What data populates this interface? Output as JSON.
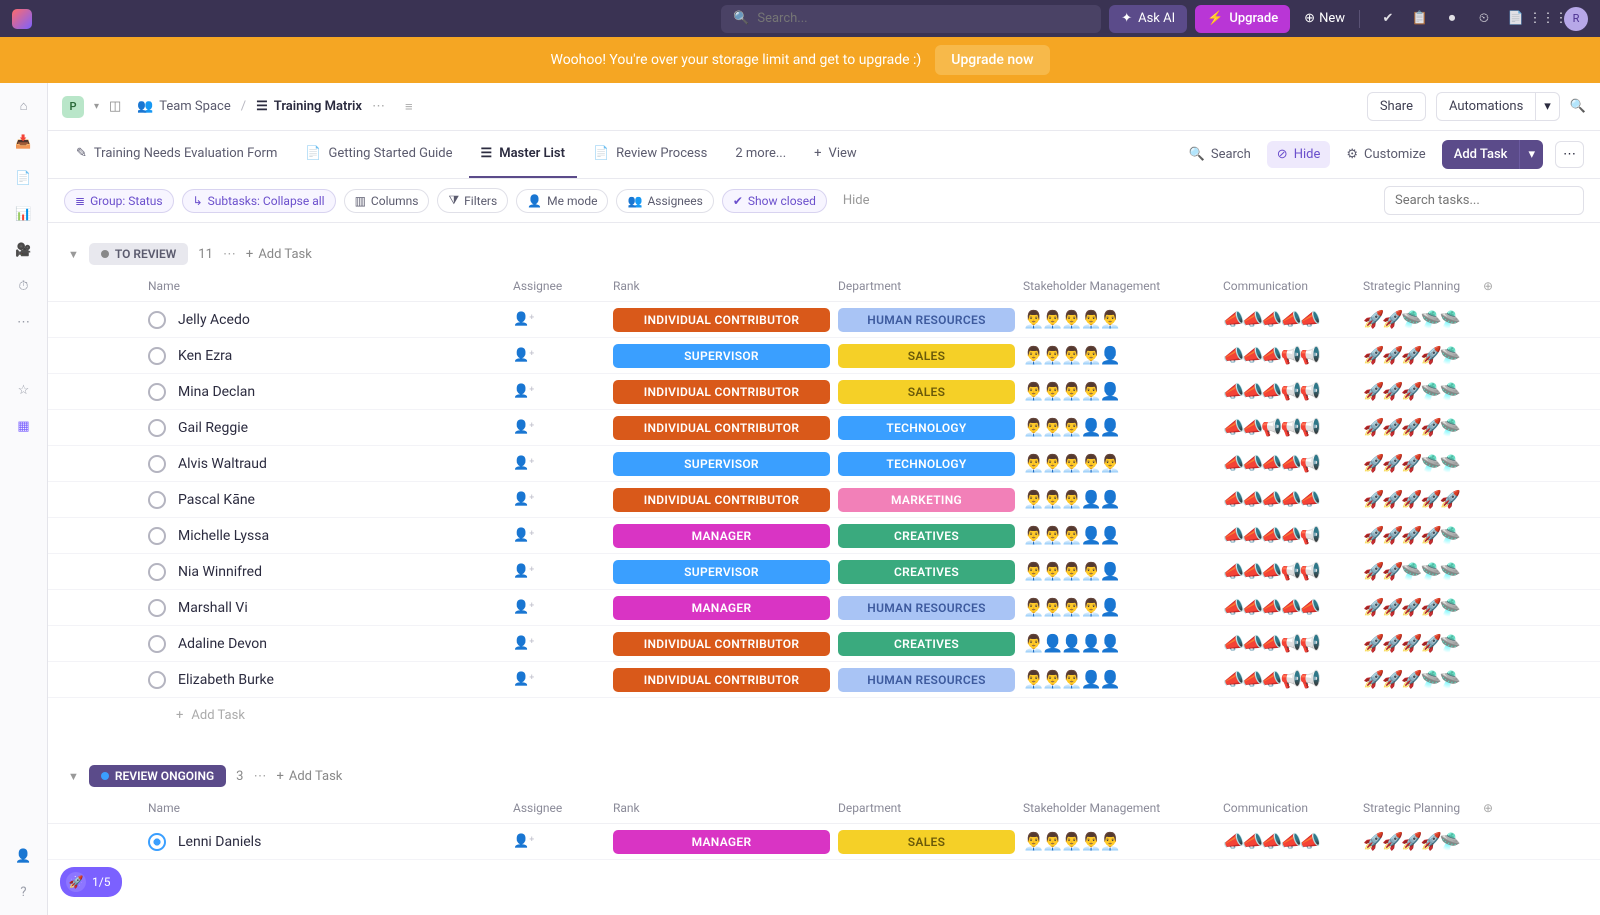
{
  "search_placeholder": "Search...",
  "ask_ai": "Ask AI",
  "upgrade": "Upgrade",
  "new": "New",
  "avatar": "R",
  "banner": {
    "text": "Woohoo! You're over your storage limit and get to upgrade :)",
    "cta": "Upgrade now"
  },
  "workspace_initial": "P",
  "breadcrumb": {
    "space": "Team Space",
    "page": "Training Matrix"
  },
  "share": "Share",
  "automations": "Automations",
  "tabs": [
    "Training Needs Evaluation Form",
    "Getting Started Guide",
    "Master List",
    "Review Process",
    "2 more...",
    "View"
  ],
  "tab_actions": {
    "search": "Search",
    "hide": "Hide",
    "customize": "Customize",
    "add_task": "Add Task"
  },
  "filters": {
    "group": "Group: Status",
    "subtasks": "Subtasks: Collapse all",
    "columns": "Columns",
    "filters": "Filters",
    "me": "Me mode",
    "assignees": "Assignees",
    "closed": "Show closed",
    "hide": "Hide",
    "search_ph": "Search tasks..."
  },
  "columns": [
    "Name",
    "Assignee",
    "Rank",
    "Department",
    "Stakeholder Management",
    "Communication",
    "Strategic Planning"
  ],
  "add_task_label": "Add Task",
  "onboard": "1/5",
  "groups": [
    {
      "name": "TO REVIEW",
      "count": 11,
      "pill": "default",
      "rows": [
        {
          "name": "Jelly Acedo",
          "rank": "INDIVIDUAL CONTRIBUTOR",
          "rank_c": "ic",
          "dept": "HUMAN RESOURCES",
          "dept_c": "hr",
          "stake": 5,
          "comm": 5,
          "strat": 2
        },
        {
          "name": "Ken Ezra",
          "rank": "SUPERVISOR",
          "rank_c": "sup",
          "dept": "SALES",
          "dept_c": "sales",
          "stake": 4,
          "comm": 3,
          "strat": 4
        },
        {
          "name": "Mina Declan",
          "rank": "INDIVIDUAL CONTRIBUTOR",
          "rank_c": "ic",
          "dept": "SALES",
          "dept_c": "sales",
          "stake": 4,
          "comm": 3,
          "strat": 3
        },
        {
          "name": "Gail Reggie",
          "rank": "INDIVIDUAL CONTRIBUTOR",
          "rank_c": "ic",
          "dept": "TECHNOLOGY",
          "dept_c": "tech",
          "stake": 3,
          "comm": 2,
          "strat": 4
        },
        {
          "name": "Alvis Waltraud",
          "rank": "SUPERVISOR",
          "rank_c": "sup",
          "dept": "TECHNOLOGY",
          "dept_c": "tech",
          "stake": 5,
          "comm": 4,
          "strat": 3
        },
        {
          "name": "Pascal Kāne",
          "rank": "INDIVIDUAL CONTRIBUTOR",
          "rank_c": "ic",
          "dept": "MARKETING",
          "dept_c": "mkt",
          "stake": 3,
          "comm": 5,
          "strat": 5
        },
        {
          "name": "Michelle Lyssa",
          "rank": "MANAGER",
          "rank_c": "mgr",
          "dept": "CREATIVES",
          "dept_c": "crea",
          "stake": 3,
          "comm": 4,
          "strat": 4
        },
        {
          "name": "Nia Winnifred",
          "rank": "SUPERVISOR",
          "rank_c": "sup",
          "dept": "CREATIVES",
          "dept_c": "crea",
          "stake": 4,
          "comm": 3,
          "strat": 2
        },
        {
          "name": "Marshall Vi",
          "rank": "MANAGER",
          "rank_c": "mgr",
          "dept": "HUMAN RESOURCES",
          "dept_c": "hr",
          "stake": 4,
          "comm": 5,
          "strat": 4
        },
        {
          "name": "Adaline Devon",
          "rank": "INDIVIDUAL CONTRIBUTOR",
          "rank_c": "ic",
          "dept": "CREATIVES",
          "dept_c": "crea",
          "stake": 1,
          "comm": 3,
          "strat": 4
        },
        {
          "name": "Elizabeth Burke",
          "rank": "INDIVIDUAL CONTRIBUTOR",
          "rank_c": "ic",
          "dept": "HUMAN RESOURCES",
          "dept_c": "hr",
          "stake": 3,
          "comm": 3,
          "strat": 3
        }
      ]
    },
    {
      "name": "REVIEW ONGOING",
      "count": 3,
      "pill": "ongoing",
      "rows": [
        {
          "name": "Lenni Daniels",
          "rank": "MANAGER",
          "rank_c": "mgr",
          "dept": "SALES",
          "dept_c": "sales",
          "stake": 5,
          "comm": 5,
          "strat": 4
        }
      ]
    }
  ]
}
